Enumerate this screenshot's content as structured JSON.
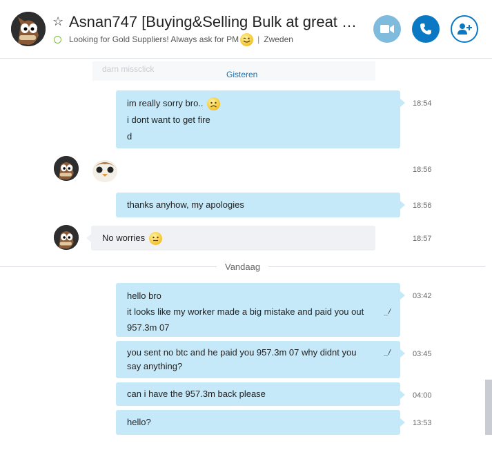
{
  "header": {
    "title": "Asnan747 [Buying&Selling Bulk at great rat…",
    "status": "Looking for Gold Suppliers!  Always ask for PM",
    "location": "Zweden",
    "status_color": "#7cbd3a",
    "icons": [
      "star-icon",
      "video-icon",
      "phone-icon",
      "add-contact-icon"
    ]
  },
  "conversation": {
    "faded_text": "darn missclick",
    "yesterday_label": "Gisteren",
    "today_label": "Vandaag",
    "messages": [
      {
        "lines": [
          "im really sorry bro..",
          "i dont want to get fire",
          "d"
        ],
        "time": "18:54",
        "emoji": "sad-emoji"
      },
      {
        "lines": [],
        "time": "18:56",
        "sticker": "porg-sticker"
      },
      {
        "lines": [
          "thanks anyhow, my apologies"
        ],
        "time": "18:56"
      },
      {
        "lines": [
          "No worries"
        ],
        "time": "18:57",
        "emoji": "smile-emoji"
      },
      {
        "lines": [
          "hello bro",
          "it looks like my worker made a big mistake and paid you out",
          "957.3m 07"
        ],
        "time": "03:42",
        "edited": true
      },
      {
        "lines": [
          "you sent no btc and he paid you 957.3m 07 why didnt you",
          "say anything?"
        ],
        "time": "03:45",
        "edited": true
      },
      {
        "lines": [
          "can i have the 957.3m back please"
        ],
        "time": "04:00"
      },
      {
        "lines": [
          "hello?"
        ],
        "time": "13:53"
      }
    ]
  },
  "colors": {
    "outgoing_bubble": "#c6e9fa",
    "incoming_bubble": "#eff1f5",
    "accent": "#0b78c4"
  }
}
